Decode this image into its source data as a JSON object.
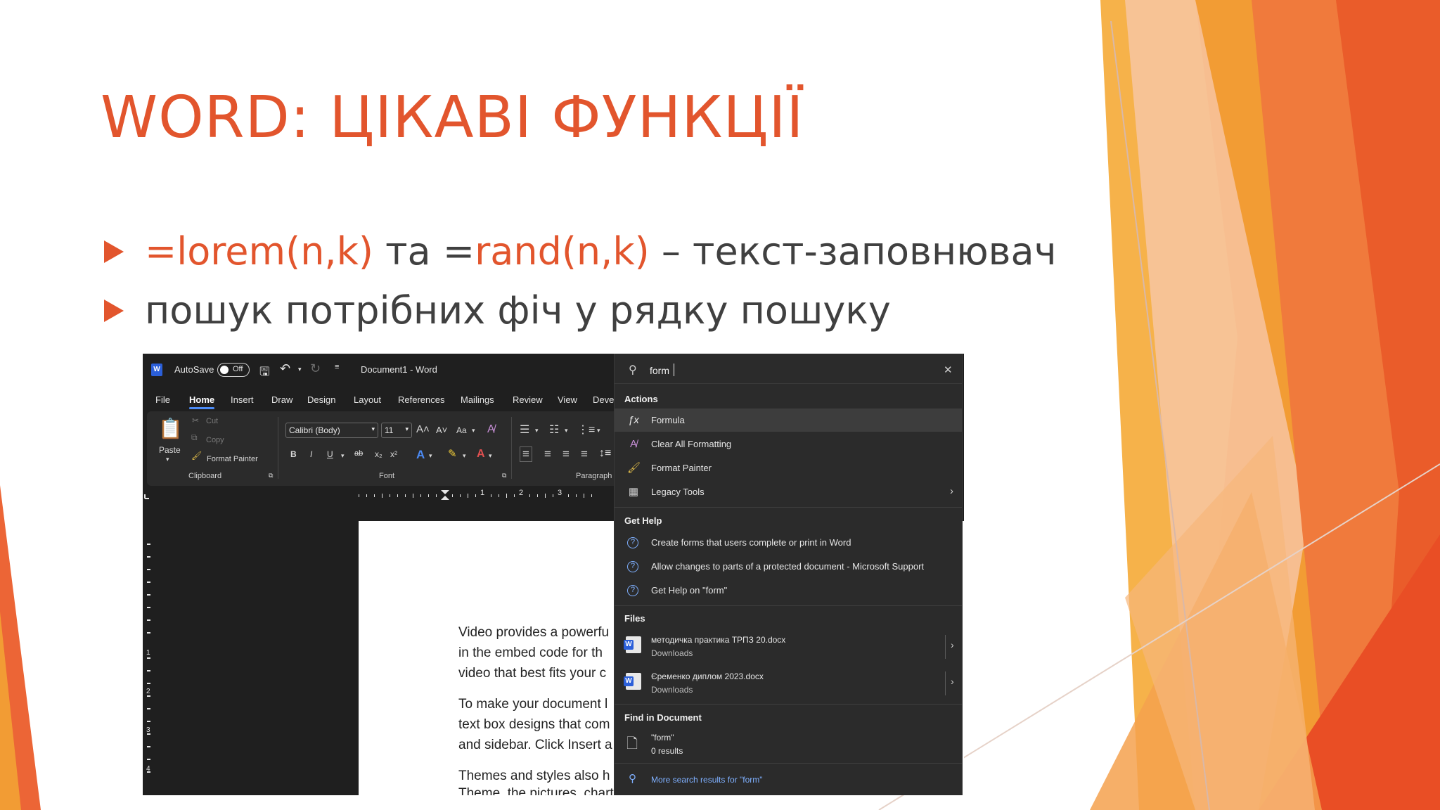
{
  "slide": {
    "title": "WORD: ЦІКАВІ ФУНКЦІЇ",
    "bullets": [
      {
        "part1": "=lorem(n,k)",
        "part2": " та =",
        "part3": "rand(n,k)",
        "part4": " – текст-заповнювач"
      },
      {
        "text": "пошук потрібних фіч у рядку пошуку"
      }
    ]
  },
  "word": {
    "autosave_label": "AutoSave",
    "autosave_state": "Off",
    "doc_title": "Document1  -  Word",
    "tabs": [
      "File",
      "Home",
      "Insert",
      "Draw",
      "Design",
      "Layout",
      "References",
      "Mailings",
      "Review",
      "View",
      "Deve"
    ],
    "active_tab": "Home",
    "clipboard": {
      "paste": "Paste",
      "cut": "Cut",
      "copy": "Copy",
      "format_painter": "Format Painter",
      "group": "Clipboard"
    },
    "font": {
      "name": "Calibri (Body)",
      "size": "11",
      "case": "Aa",
      "group": "Font"
    },
    "paragraph_group": "Paragraph",
    "ruler_marks": [
      "1",
      "2",
      "3"
    ],
    "vruler_marks": [
      "1",
      "2",
      "3",
      "4"
    ],
    "doc_lines": [
      "Video provides a powerfu",
      "in the embed code for th",
      "video that best fits your c",
      "To make your document l",
      "text box designs that com",
      "and sidebar. Click Insert a",
      "Themes and styles also h",
      "Theme, the pictures, charts, and SmartArt graphics change to match your new the"
    ]
  },
  "search": {
    "query": "form",
    "actions_header": "Actions",
    "actions": [
      {
        "label": "Formula",
        "icon": "formula-icon"
      },
      {
        "label": "Clear All Formatting",
        "icon": "clear-formatting-icon"
      },
      {
        "label": "Format Painter",
        "icon": "format-painter-icon"
      },
      {
        "label": "Legacy Tools",
        "icon": "legacy-tools-icon"
      }
    ],
    "help_header": "Get Help",
    "help": [
      "Create forms that users complete or print in Word",
      "Allow changes to parts of a protected document - Microsoft Support",
      "Get Help on \"form\""
    ],
    "files_header": "Files",
    "files": [
      {
        "name": "методичка практика ТРПЗ 20.docx",
        "location": "Downloads"
      },
      {
        "name": "Єременко диплом 2023.docx",
        "location": "Downloads"
      }
    ],
    "find_header": "Find in Document",
    "find_term": "\"form\"",
    "find_results": "0 results",
    "more_results": "More search results for \"form\""
  },
  "colors": {
    "accent": "#e2552d",
    "body_text": "#404040",
    "word_blue": "#2b5fd9"
  }
}
